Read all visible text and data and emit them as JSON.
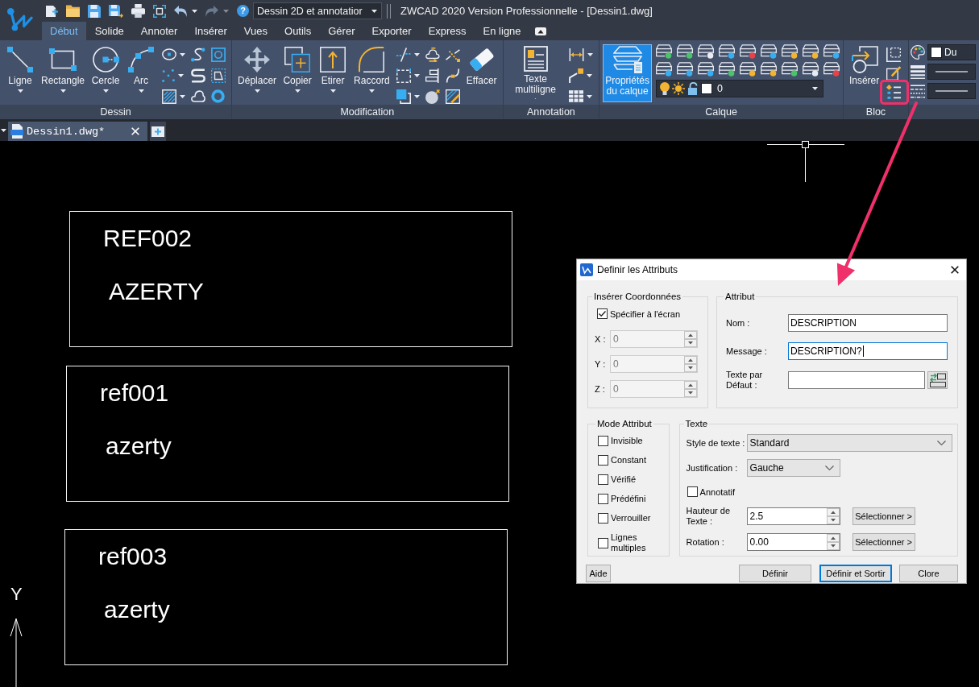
{
  "title_bar": {
    "quick_access": [
      {
        "kind": "icon",
        "menu": false,
        "disabled": false
      },
      {
        "kind": "icon",
        "menu": false,
        "disabled": false
      },
      {
        "kind": "icon",
        "menu": false,
        "disabled": false
      },
      {
        "kind": "icon",
        "menu": false,
        "disabled": false
      },
      {
        "kind": "icon",
        "menu": false,
        "disabled": false
      },
      {
        "kind": "icon",
        "menu": false,
        "disabled": false
      },
      {
        "kind": "icon",
        "menu": true,
        "disabled": false
      },
      {
        "kind": "icon",
        "menu": true,
        "disabled": true
      },
      {
        "kind": "glyph",
        "glyph": "?",
        "menu": false,
        "disabled": false
      }
    ],
    "workspace": {
      "value": "Dessin 2D et annotatior"
    },
    "title": "ZWCAD 2020 Version Professionnelle - [Dessin1.dwg]"
  },
  "ribbon": {
    "tabs": [
      {
        "label": "Début",
        "selected": true
      },
      {
        "label": "Solide",
        "selected": false
      },
      {
        "label": "Annoter",
        "selected": false
      },
      {
        "label": "Insérer",
        "selected": false
      },
      {
        "label": "Vues",
        "selected": false
      },
      {
        "label": "Outils",
        "selected": false
      },
      {
        "label": "Gérer",
        "selected": false
      },
      {
        "label": "Exporter",
        "selected": false
      },
      {
        "label": "Express",
        "selected": false
      },
      {
        "label": "En ligne",
        "selected": false
      }
    ],
    "panels": [
      {
        "title": "Dessin",
        "tools": [
          {
            "kind": "large",
            "label": "Ligne",
            "menu": true,
            "active": false
          },
          {
            "kind": "large",
            "label": "Rectangle",
            "menu": true,
            "active": false
          },
          {
            "kind": "large",
            "label": "Cercle",
            "menu": true,
            "active": false
          },
          {
            "kind": "large",
            "label": "Arc",
            "menu": true,
            "active": false
          },
          {
            "kind": "grid",
            "rows": [
              [
                {
                  "menu": true,
                  "highlighted": false
                },
                {
                  "menu": false,
                  "highlighted": false
                },
                {
                  "menu": false,
                  "highlighted": false
                }
              ],
              [
                {
                  "menu": true,
                  "highlighted": false
                },
                {
                  "menu": false,
                  "highlighted": false
                },
                {
                  "menu": false,
                  "highlighted": false
                }
              ],
              [
                {
                  "menu": true,
                  "highlighted": false
                },
                {
                  "menu": false,
                  "highlighted": false
                },
                {
                  "menu": false,
                  "highlighted": false
                }
              ]
            ]
          }
        ]
      },
      {
        "title": "Modification",
        "tools": [
          {
            "kind": "large",
            "label": "Déplacer",
            "menu": true,
            "active": false
          },
          {
            "kind": "large",
            "label": "Copier",
            "menu": true,
            "active": false
          },
          {
            "kind": "large",
            "label": "Etirer",
            "menu": true,
            "active": false
          },
          {
            "kind": "large",
            "label": "Raccord",
            "menu": true,
            "active": false
          },
          {
            "kind": "grid",
            "rows": [
              [
                {
                  "menu": true,
                  "highlighted": false
                },
                {
                  "menu": false,
                  "highlighted": false
                },
                {
                  "menu": false,
                  "highlighted": false
                }
              ],
              [
                {
                  "menu": true,
                  "highlighted": false
                },
                {
                  "menu": false,
                  "highlighted": false
                },
                {
                  "menu": false,
                  "highlighted": false
                }
              ],
              [
                {
                  "menu": true,
                  "highlighted": false
                },
                {
                  "menu": false,
                  "highlighted": false
                },
                {
                  "menu": false,
                  "highlighted": false
                }
              ]
            ]
          },
          {
            "kind": "large",
            "label": "Effacer",
            "menu": false,
            "active": false
          }
        ]
      },
      {
        "title": "Annotation",
        "tools": [
          {
            "kind": "large",
            "label": "Texte multiligne",
            "menu": true,
            "active": false
          },
          {
            "kind": "grid",
            "rows": [
              [
                {
                  "menu": true,
                  "highlighted": false
                }
              ],
              [
                {
                  "menu": true,
                  "highlighted": false
                }
              ],
              [
                {
                  "menu": true,
                  "highlighted": false
                }
              ]
            ]
          }
        ]
      },
      {
        "title": "Calque",
        "tools": [
          {
            "kind": "large",
            "label": "Propriétés du calque",
            "menu": false,
            "active": true
          },
          {
            "kind": "column",
            "items": [
              {
                "kind": "grid",
                "rows": [
                  [
                    {
                      "menu": false,
                      "highlighted": false
                    },
                    {
                      "menu": false,
                      "highlighted": false
                    },
                    {
                      "menu": false,
                      "highlighted": false
                    },
                    {
                      "menu": false,
                      "highlighted": false
                    },
                    {
                      "menu": false,
                      "highlighted": false
                    },
                    {
                      "menu": false,
                      "highlighted": false
                    },
                    {
                      "menu": false,
                      "highlighted": false
                    },
                    {
                      "menu": false,
                      "highlighted": false
                    },
                    {
                      "menu": false,
                      "highlighted": false
                    }
                  ],
                  [
                    {
                      "menu": false,
                      "highlighted": false
                    },
                    {
                      "menu": false,
                      "highlighted": false
                    },
                    {
                      "menu": false,
                      "highlighted": false
                    },
                    {
                      "menu": false,
                      "highlighted": false
                    },
                    {
                      "menu": false,
                      "highlighted": false
                    },
                    {
                      "menu": false,
                      "highlighted": false
                    },
                    {
                      "menu": false,
                      "highlighted": false
                    },
                    {
                      "menu": false,
                      "highlighted": false
                    },
                    {
                      "menu": false,
                      "highlighted": false
                    }
                  ]
                ]
              },
              {
                "kind": "layer_combo",
                "value": "0"
              }
            ]
          }
        ]
      },
      {
        "title": "Bloc",
        "tools": [
          {
            "kind": "large",
            "label": "Insérer",
            "menu": false,
            "active": false
          },
          {
            "kind": "grid",
            "rows": [
              [
                {
                  "menu": false,
                  "highlighted": false
                }
              ],
              [
                {
                  "menu": false,
                  "highlighted": false
                }
              ],
              [
                {
                  "menu": false,
                  "highlighted": true
                }
              ]
            ]
          }
        ]
      },
      {
        "tools": [
          {
            "kind": "column",
            "items": [
              {
                "kind": "color_combo",
                "value": "Du"
              },
              {
                "kind": "line_combo"
              },
              {
                "kind": "line_combo"
              }
            ]
          }
        ]
      }
    ]
  },
  "documents": {
    "tabs": [
      {
        "title": "Dessin1.dwg*",
        "selected": true
      }
    ]
  },
  "drawing": {
    "blocks": [
      {
        "lines": [
          "REF002",
          "AZERTY"
        ]
      },
      {
        "lines": [
          "ref001",
          "azerty"
        ]
      },
      {
        "lines": [
          "ref003",
          "azerty"
        ]
      }
    ],
    "ucs_label": "Y"
  },
  "dialog": {
    "title": "Definir les Attributs",
    "insert_coordinates": {
      "title": "Insérer Coordonnées",
      "specify_on_screen": {
        "label": "Spécifier à l'écran",
        "checked": true
      },
      "fields": [
        {
          "label": "X :",
          "value": "0",
          "disabled": true
        },
        {
          "label": "Y :",
          "value": "0",
          "disabled": true
        },
        {
          "label": "Z :",
          "value": "0",
          "disabled": true
        }
      ]
    },
    "attribute": {
      "title": "Attribut",
      "fields": [
        {
          "kind": "text",
          "label": "Nom :",
          "value": "DESCRIPTION",
          "focused": false
        },
        {
          "kind": "text",
          "label": "Message :",
          "value": "DESCRIPTION?",
          "focused": true
        },
        {
          "kind": "text_with_button",
          "label": "Texte par Défaut :",
          "focused": false
        }
      ]
    },
    "mode": {
      "title": "Mode Attribut",
      "options": [
        {
          "label": "Invisible",
          "checked": false
        },
        {
          "label": "Constant",
          "checked": false
        },
        {
          "label": "Vérifié",
          "checked": false
        },
        {
          "label": "Prédéfini",
          "checked": false
        },
        {
          "label": "Verrouiller",
          "checked": false
        },
        {
          "label": "Lignes multiples",
          "checked": false
        }
      ]
    },
    "text_options": {
      "title": "Texte",
      "rows": [
        {
          "kind": "wide_combo",
          "label": "Style de texte :",
          "value": "Standard"
        },
        {
          "kind": "combo",
          "label": "Justification :",
          "value": "Gauche"
        },
        {
          "kind": "checkbox",
          "label": "Annotatif",
          "checked": false
        },
        {
          "kind": "spin",
          "label": "Hauteur de Texte :",
          "value": "2.5",
          "button": "Sélectionner >"
        },
        {
          "kind": "spin",
          "label": "Rotation :",
          "value": "0.00",
          "button": "Sélectionner >"
        }
      ]
    },
    "buttons": [
      {
        "kind": "help",
        "label": "Aide",
        "default": false
      },
      {
        "kind": "action",
        "label": "Définir",
        "default": false
      },
      {
        "kind": "action",
        "label": "Définir et Sortir",
        "default": true
      },
      {
        "kind": "action",
        "label": "Clore",
        "default": false
      }
    ]
  }
}
